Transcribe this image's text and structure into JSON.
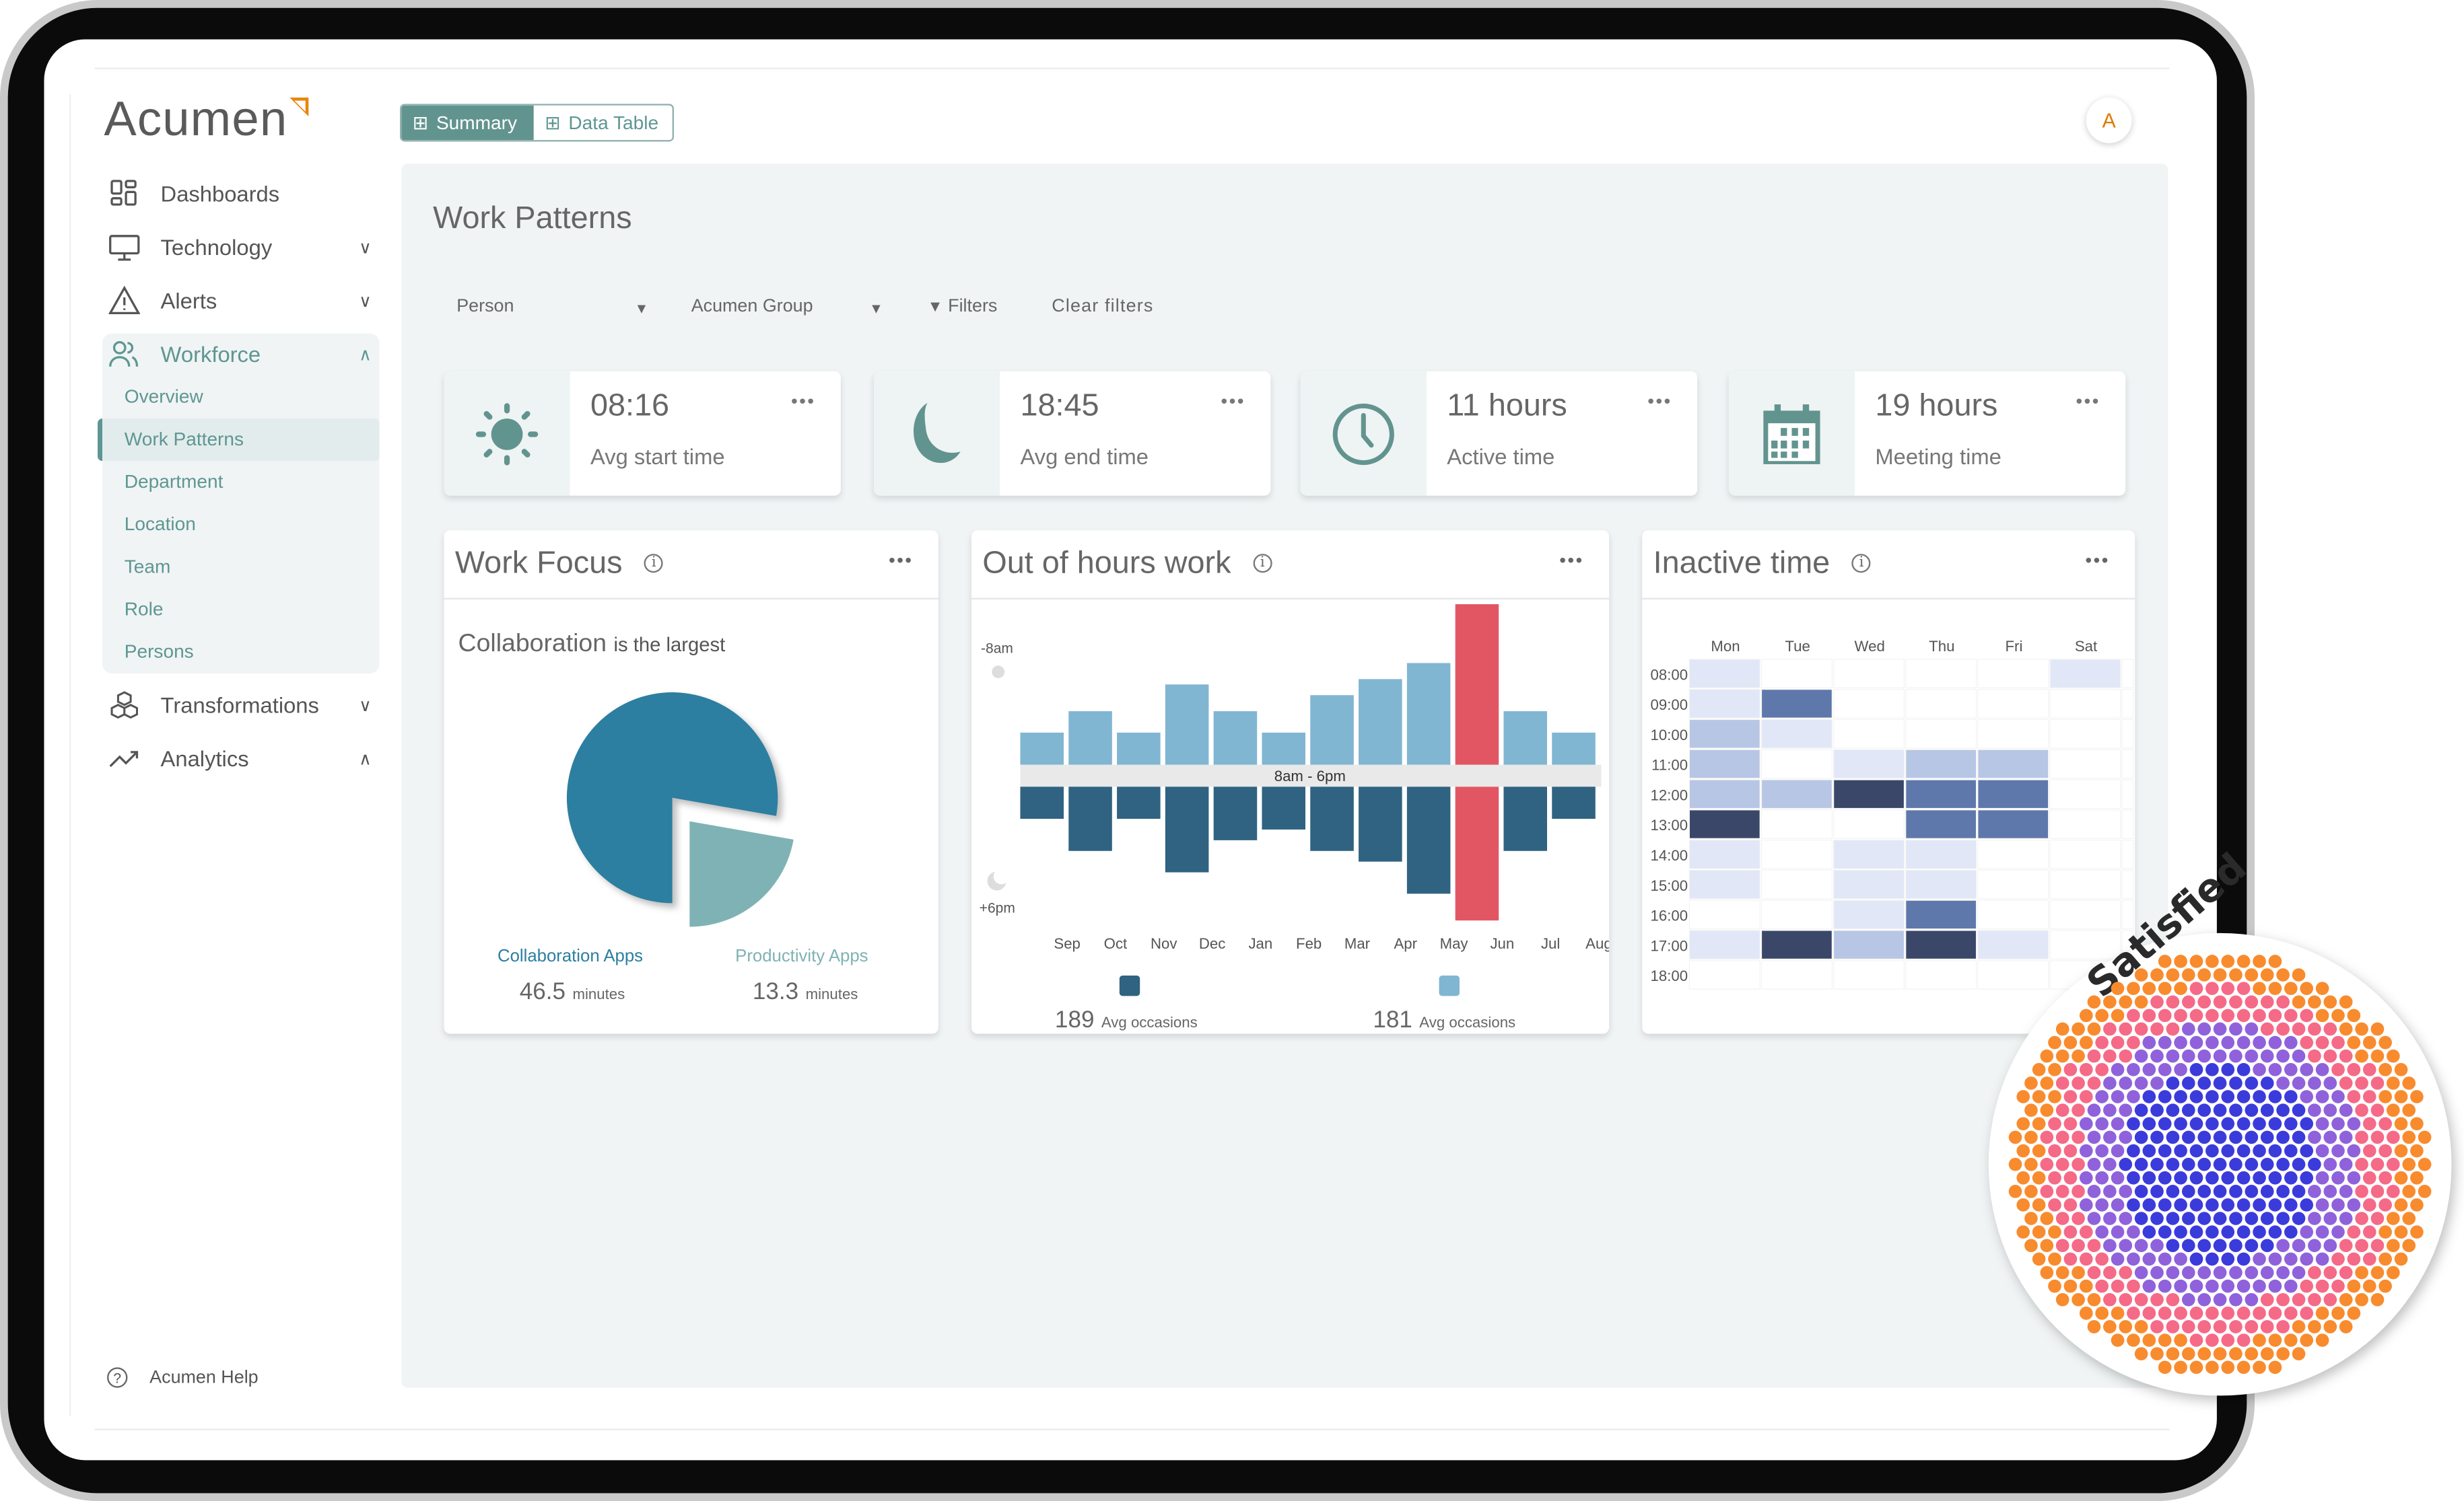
{
  "app": {
    "logo": "Acumen",
    "avatar_initial": "A",
    "help": "Acumen Help"
  },
  "sidebar": {
    "items": [
      {
        "label": "Dashboards",
        "icon": "dashboard-icon"
      },
      {
        "label": "Technology",
        "icon": "monitor-icon",
        "chevron": "down"
      },
      {
        "label": "Alerts",
        "icon": "warning-icon",
        "chevron": "down"
      },
      {
        "label": "Workforce",
        "icon": "people-icon",
        "chevron": "up",
        "expanded": true
      },
      {
        "label": "Transformations",
        "icon": "cubes-icon",
        "chevron": "down"
      },
      {
        "label": "Analytics",
        "icon": "trend-icon",
        "chevron": "up"
      }
    ],
    "workforce_sub": [
      "Overview",
      "Work Patterns",
      "Department",
      "Location",
      "Team",
      "Role",
      "Persons"
    ],
    "selected": "Work Patterns"
  },
  "view_toggle": {
    "summary": "Summary",
    "data_table": "Data Table",
    "active": "Summary"
  },
  "page": {
    "title": "Work Patterns"
  },
  "filters": {
    "person": "Person",
    "group": "Acumen Group",
    "filters": "Filters",
    "clear": "Clear filters"
  },
  "stats": [
    {
      "value": "08:16",
      "label": "Avg start time",
      "icon": "sun-icon"
    },
    {
      "value": "18:45",
      "label": "Avg end time",
      "icon": "moon-icon"
    },
    {
      "value": "11 hours",
      "label": "Active time",
      "icon": "clock-icon"
    },
    {
      "value": "19 hours",
      "label": "Meeting time",
      "icon": "calendar-icon"
    }
  ],
  "colors": {
    "accent": "#62948f",
    "collab": "#2c7fa0",
    "productivity": "#7fb2b4",
    "before": "#80b6d2",
    "after": "#2f6381",
    "highlight": "#e25663",
    "heat": [
      "#ffffff",
      "#e1e7f7",
      "#b7c6e4",
      "#5f78ab",
      "#3a4769"
    ]
  },
  "chart_data": [
    {
      "type": "pie",
      "title": "Work Focus",
      "subtitle_strong": "Collaboration",
      "subtitle_rest": "is the largest",
      "slices": [
        {
          "name": "Collaboration Apps",
          "value": 46.5,
          "unit": "minutes"
        },
        {
          "name": "Productivity Apps",
          "value": 13.3,
          "unit": "minutes"
        }
      ]
    },
    {
      "type": "bar",
      "title": "Out of hours work",
      "categories": [
        "Sep",
        "Oct",
        "Nov",
        "Dec",
        "Jan",
        "Feb",
        "Mar",
        "Apr",
        "May",
        "Jun",
        "Jul",
        "Aug"
      ],
      "band_label": "8am - 6pm",
      "top_label": "-8am",
      "bottom_label": "+6pm",
      "highlight": "Jun",
      "series": [
        {
          "values": [
            3,
            5,
            3,
            7.5,
            5,
            3,
            6.5,
            8,
            9.5,
            15,
            5,
            3
          ]
        },
        {
          "values": [
            3,
            6,
            3,
            8,
            5,
            4,
            6,
            7,
            10,
            12.5,
            6,
            3
          ]
        }
      ],
      "legend": [
        {
          "value": "189",
          "label": "Avg occasions"
        },
        {
          "value": "181",
          "label": "Avg occasions"
        }
      ]
    },
    {
      "type": "heatmap",
      "title": "Inactive time",
      "columns": [
        "Mon",
        "Tue",
        "Wed",
        "Thu",
        "Fri",
        "Sat"
      ],
      "rows": [
        "08:00",
        "09:00",
        "10:00",
        "11:00",
        "12:00",
        "13:00",
        "14:00",
        "15:00",
        "16:00",
        "17:00",
        "18:00"
      ],
      "values": [
        [
          1,
          0,
          0,
          0,
          0,
          1
        ],
        [
          1,
          3,
          0,
          0,
          0,
          0
        ],
        [
          2,
          1,
          0,
          0,
          0,
          0
        ],
        [
          2,
          0,
          1,
          2,
          2,
          0
        ],
        [
          2,
          2,
          4,
          3,
          3,
          0
        ],
        [
          4,
          0,
          0,
          3,
          3,
          0
        ],
        [
          1,
          0,
          1,
          1,
          0,
          0
        ],
        [
          1,
          0,
          1,
          1,
          0,
          0
        ],
        [
          0,
          0,
          1,
          3,
          0,
          0
        ],
        [
          1,
          4,
          2,
          4,
          1,
          0
        ],
        [
          0,
          0,
          0,
          0,
          0,
          0
        ]
      ]
    }
  ],
  "badge": {
    "label": "Satisfied",
    "dot_colors": [
      "#3b3bdc",
      "#8f62dc",
      "#f56a87",
      "#f88b2e"
    ]
  }
}
